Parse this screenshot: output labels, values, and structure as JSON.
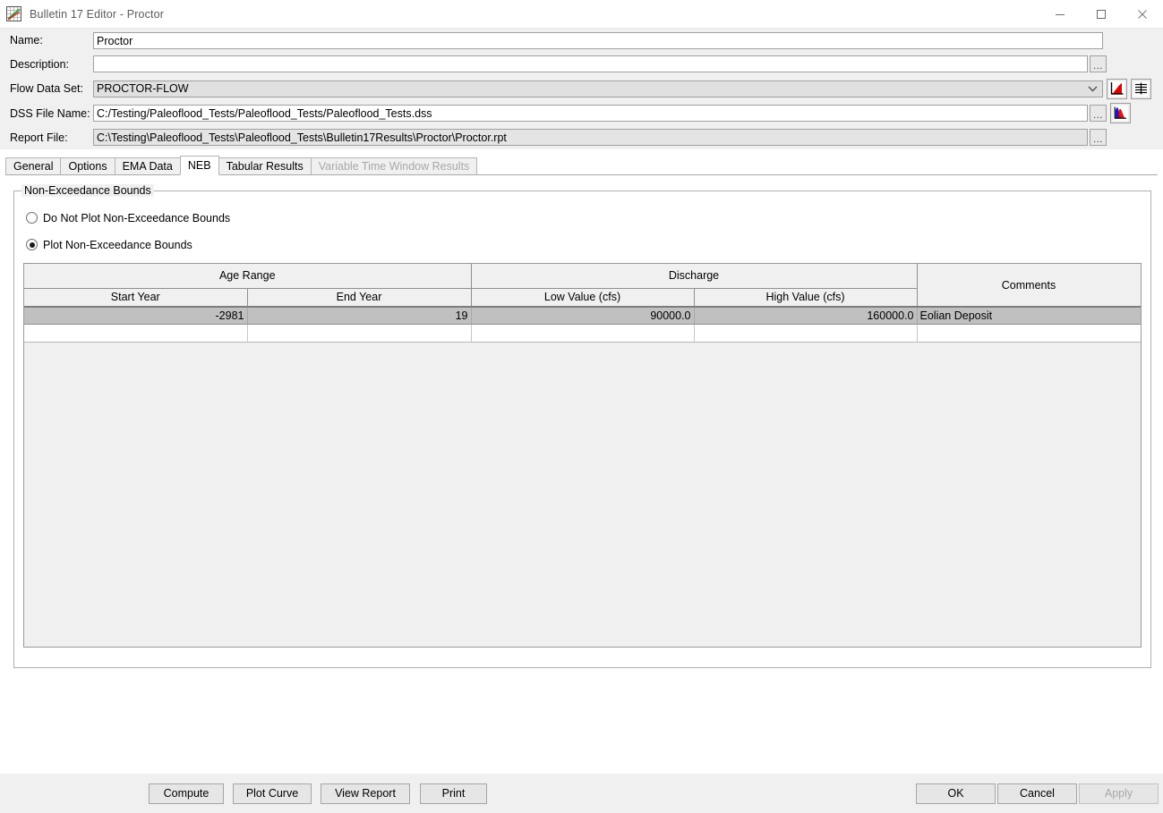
{
  "window": {
    "title": "Bulletin 17 Editor - Proctor",
    "icon": "chart-lines-icon",
    "controls": {
      "minimize": "minimize-icon",
      "maximize": "maximize-icon",
      "close": "close-icon"
    }
  },
  "form": {
    "name": {
      "label": "Name:",
      "value": "Proctor"
    },
    "description": {
      "label": "Description:",
      "value": "",
      "browse": "..."
    },
    "flow_data_set": {
      "label": "Flow Data Set:",
      "value": "PROCTOR-FLOW",
      "plot_icon": "red-curve-plot-icon",
      "table_icon": "data-table-icon"
    },
    "dss_file_name": {
      "label": "DSS File Name:",
      "value": "C:/Testing/Paleoflood_Tests/Paleoflood_Tests/Paleoflood_Tests.dss",
      "browse": "...",
      "histogram_icon": "blue-red-histogram-icon"
    },
    "report_file": {
      "label": "Report File:",
      "value": "C:\\Testing\\Paleoflood_Tests\\Paleoflood_Tests\\Bulletin17Results\\Proctor\\Proctor.rpt",
      "browse": "..."
    }
  },
  "tabs": [
    {
      "label": "General",
      "active": false,
      "disabled": false
    },
    {
      "label": "Options",
      "active": false,
      "disabled": false
    },
    {
      "label": "EMA Data",
      "active": false,
      "disabled": false
    },
    {
      "label": "NEB",
      "active": true,
      "disabled": false
    },
    {
      "label": "Tabular Results",
      "active": false,
      "disabled": false
    },
    {
      "label": "Variable Time Window Results",
      "active": false,
      "disabled": true
    }
  ],
  "neb_panel": {
    "group_title": "Non-Exceedance Bounds",
    "radio_do_not_plot": {
      "label": "Do Not Plot Non-Exceedance Bounds",
      "selected": false
    },
    "radio_plot": {
      "label": "Plot Non-Exceedance Bounds",
      "selected": true
    },
    "table": {
      "group_headers": {
        "age_range": "Age Range",
        "discharge": "Discharge",
        "comments": "Comments"
      },
      "sub_headers": {
        "start_year": "Start Year",
        "end_year": "End Year",
        "low_value": "Low Value (cfs)",
        "high_value": "High Value (cfs)"
      },
      "rows": [
        {
          "start_year": "-2981",
          "end_year": "19",
          "low_value": "90000.0",
          "high_value": "160000.0",
          "comments": "Eolian Deposit",
          "selected": true
        },
        {
          "start_year": "",
          "end_year": "",
          "low_value": "",
          "high_value": "",
          "comments": "",
          "selected": false
        }
      ]
    }
  },
  "footer": {
    "compute": {
      "label": "Compute",
      "disabled": false
    },
    "plot_curve": {
      "label": "Plot Curve",
      "disabled": false
    },
    "view_report": {
      "label": "View Report",
      "disabled": false
    },
    "print": {
      "label": "Print",
      "disabled": false
    },
    "ok": {
      "label": "OK",
      "disabled": false
    },
    "cancel": {
      "label": "Cancel",
      "disabled": false
    },
    "apply": {
      "label": "Apply",
      "disabled": true
    }
  },
  "colors": {
    "window_bg": "#f0f0f0",
    "title_text": "#5a5a5a",
    "selected_row": "#c0c0c0",
    "readonly_field": "#e4e4e4",
    "disabled_text": "#a8a8a8",
    "accent_red": "#e00000",
    "accent_blue": "#1414d2",
    "accent_green": "#2d9b2d"
  }
}
